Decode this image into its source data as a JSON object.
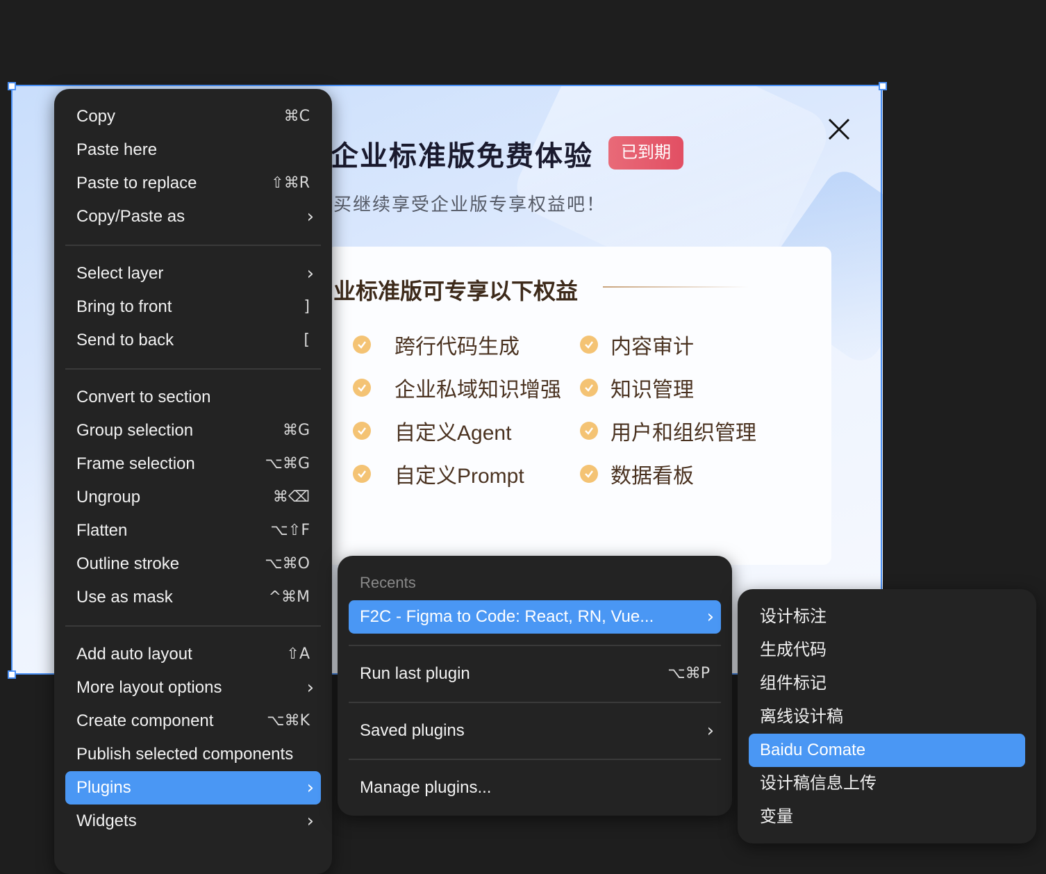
{
  "canvas": {
    "title": "企业标准版免费体验",
    "badge": "已到期",
    "subtitle": "买继续享受企业版专享权益吧！",
    "card_title": "业标准版可专享以下权益",
    "benefits_left": [
      "跨行代码生成",
      "企业私域知识增强",
      "自定义Agent",
      "自定义Prompt"
    ],
    "benefits_right": [
      "内容审计",
      "知识管理",
      "用户和组织管理",
      "数据看板"
    ],
    "close_icon": "close-icon",
    "accent_color": "#4a90f5"
  },
  "context_menu": {
    "items": [
      {
        "label": "Copy",
        "shortcut": "⌘C"
      },
      {
        "label": "Paste here",
        "shortcut": ""
      },
      {
        "label": "Paste to replace",
        "shortcut": "⇧⌘R"
      },
      {
        "label": "Copy/Paste as",
        "shortcut": "›"
      },
      {
        "label": "Select layer",
        "shortcut": "›"
      },
      {
        "label": "Bring to front",
        "shortcut": "]"
      },
      {
        "label": "Send to back",
        "shortcut": "["
      },
      {
        "label": "Convert to section",
        "shortcut": ""
      },
      {
        "label": "Group selection",
        "shortcut": "⌘G"
      },
      {
        "label": "Frame selection",
        "shortcut": "⌥⌘G"
      },
      {
        "label": "Ungroup",
        "shortcut": "⌘⌫"
      },
      {
        "label": "Flatten",
        "shortcut": "⌥⇧F"
      },
      {
        "label": "Outline stroke",
        "shortcut": "⌥⌘O"
      },
      {
        "label": "Use as mask",
        "shortcut": "^⌘M"
      },
      {
        "label": "Add auto layout",
        "shortcut": "⇧A"
      },
      {
        "label": "More layout options",
        "shortcut": "›"
      },
      {
        "label": "Create component",
        "shortcut": "⌥⌘K"
      },
      {
        "label": "Publish selected components",
        "shortcut": ""
      },
      {
        "label": "Plugins",
        "shortcut": "›"
      },
      {
        "label": "Widgets",
        "shortcut": "›"
      }
    ]
  },
  "plugins_menu": {
    "section_label": "Recents",
    "recent": "F2C - Figma to Code: React, RN, Vue...",
    "run_last": "Run last plugin",
    "run_last_shortcut": "⌥⌘P",
    "saved": "Saved plugins",
    "manage": "Manage plugins...",
    "arrow": "›"
  },
  "f2c_menu": {
    "items": [
      "设计标注",
      "生成代码",
      "组件标记",
      "离线设计稿",
      "Baidu Comate",
      "设计稿信息上传",
      "变量"
    ]
  },
  "highlight_color": "#4a97f4"
}
